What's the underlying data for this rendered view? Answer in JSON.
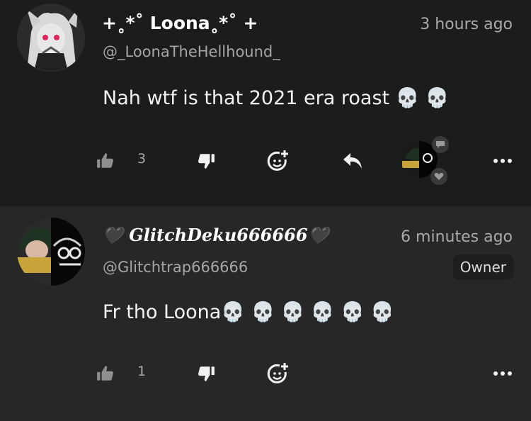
{
  "comments": [
    {
      "name": "+˳*˚ Loona˳*˚ +",
      "handle": "@_LoonaTheHellhound_",
      "time": "3 hours ago",
      "body": "Nah wtf is that 2021 era roast 💀 💀",
      "likes": "3"
    },
    {
      "name": "🖤 GlitchDeku666666🖤",
      "handle": "@Glitchtrap666666",
      "time": "6 minutes ago",
      "badge": "Owner",
      "body": "Fr tho Loona💀 💀 💀 💀 💀 💀",
      "likes": "1"
    }
  ],
  "icons": {
    "like": "thumbs-up-icon",
    "dislike": "thumbs-down-icon",
    "emote": "add-reaction-icon",
    "reply": "reply-icon",
    "more": "more-icon"
  }
}
